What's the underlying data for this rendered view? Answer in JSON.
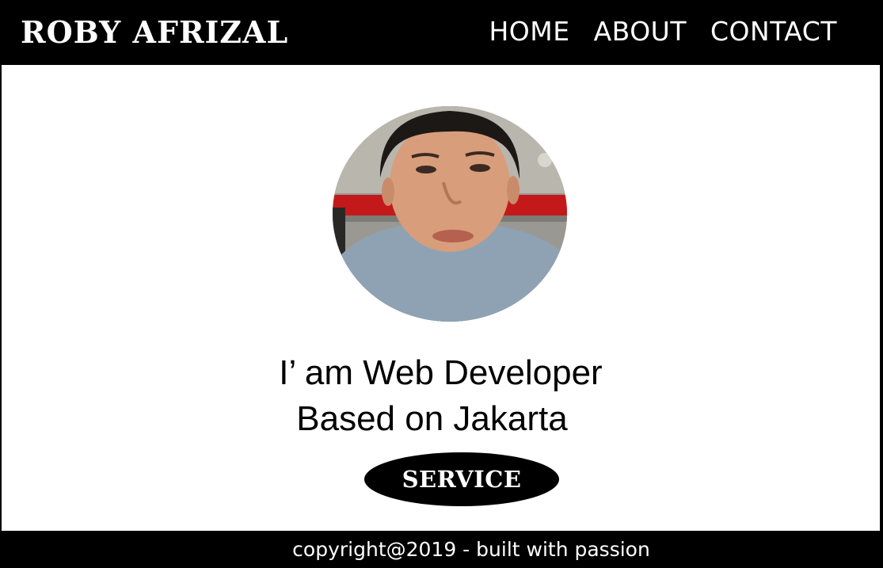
{
  "header": {
    "brand": "ROBY AFRIZAL",
    "nav": [
      {
        "label": "HOME"
      },
      {
        "label": "ABOUT"
      },
      {
        "label": "CONTACT"
      }
    ]
  },
  "hero": {
    "headline_line1": "I’ am Web Developer",
    "headline_line2": "Based on Jakarta",
    "service_label": "SERVICE"
  },
  "footer": {
    "copyright": "copyright@2019 - built with passion"
  },
  "colors": {
    "header_bg": "#000000",
    "panel_bg": "#ffffff",
    "text_light": "#ffffff",
    "text_dark": "#000000"
  }
}
